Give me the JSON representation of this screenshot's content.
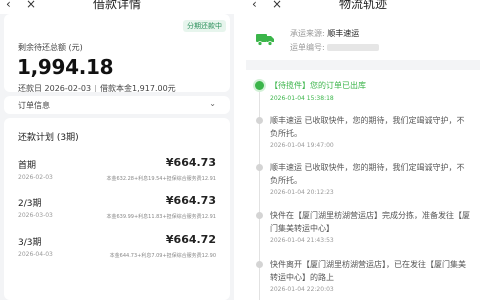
{
  "left": {
    "title": "借款详情",
    "tag": "分期还款中",
    "remain_label": "剩余待还总额 (元)",
    "remain_amount": "1,994.18",
    "repay_date": "还款日 2026-02-03",
    "loan_amount": "借款本金1,917.00元",
    "order_info_label": "订单信息",
    "plan_title": "还款计划 (3期)",
    "installments": [
      {
        "name": "首期",
        "amount": "¥664.73",
        "date": "2026-02-03",
        "detail": "本金632.28+利息19.54+担保综合服务费12.91"
      },
      {
        "name": "2/3期",
        "amount": "¥664.73",
        "date": "2026-03-03",
        "detail": "本金639.99+利息11.83+担保综合服务费12.91"
      },
      {
        "name": "3/3期",
        "amount": "¥664.72",
        "date": "2026-04-03",
        "detail": "本金644.73+利息7.09+担保综合服务费12.90"
      }
    ]
  },
  "right": {
    "title": "物流轨迹",
    "carrier_label": "承运来源:",
    "carrier_value": "顺丰速运",
    "waybill_label": "运单编号:",
    "events": [
      {
        "text": "【待揽件】您的订单已出库",
        "time": "2026-01-04 15:38:18",
        "active": true
      },
      {
        "text": "顺丰速运 已收取快件，您的期待，我们定竭诚守护，不负所托。",
        "time": "2026-01-04 19:47:00",
        "active": false
      },
      {
        "text": "顺丰速运 已收取快件，您的期待，我们定竭诚守护，不负所托。",
        "time": "2026-01-04 20:12:23",
        "active": false
      },
      {
        "text": "快件在【厦门湖里枋湖营运店】完成分拣，准备发往【厦门集美转运中心】",
        "time": "2026-01-04 21:43:53",
        "active": false
      },
      {
        "text": "快件离开【厦门湖里枋湖营运店】，已在发往【厦门集美转运中心】的路上",
        "time": "2026-01-04 22:20:03",
        "active": false
      }
    ]
  },
  "icons": {
    "back": "‹",
    "close": "×",
    "chevron": "⌄"
  },
  "colors": {
    "accent_green": "#3bb54a",
    "tag_green": "#2a8f5a",
    "panel_bg": "#f3f4f6"
  }
}
